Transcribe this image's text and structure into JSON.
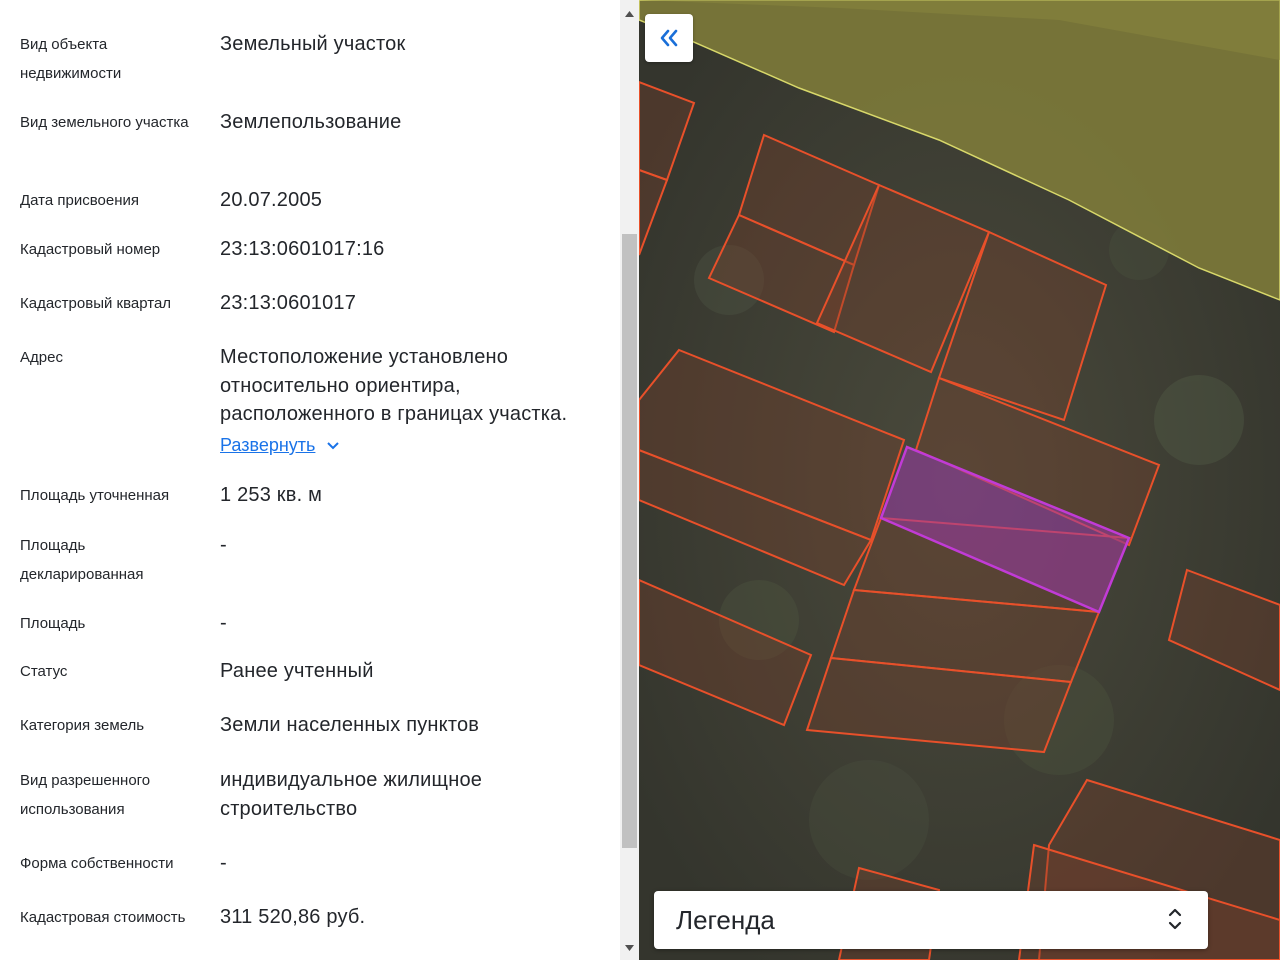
{
  "properties": [
    {
      "label": "Вид объекта недвижимости",
      "value": "Земельный участок"
    },
    {
      "label": "Вид земельного участка",
      "value": "Землепользование"
    },
    {
      "label": "Дата присвоения",
      "value": "20.07.2005"
    },
    {
      "label": "Кадастровый номер",
      "value": "23:13:0601017:16"
    },
    {
      "label": "Кадастровый квартал",
      "value": "23:13:0601017"
    },
    {
      "label": "Адрес",
      "value": "Местоположение установлено относительно ориентира, расположенного в границах участка.",
      "expand_label": "Развернуть"
    },
    {
      "label": "Площадь уточненная",
      "value": "1 253 кв. м"
    },
    {
      "label": "Площадь декларированная",
      "value": "-"
    },
    {
      "label": "Площадь",
      "value": "-"
    },
    {
      "label": "Статус",
      "value": "Ранее учтенный"
    },
    {
      "label": "Категория земель",
      "value": "Земли населенных пунктов"
    },
    {
      "label": "Вид разрешенного использования",
      "value": "индивидуальное жилищное строительство"
    },
    {
      "label": "Форма собственности",
      "value": "-"
    },
    {
      "label": "Кадастровая стоимость",
      "value": "311 520,86 руб."
    }
  ],
  "map": {
    "collapse_icon": "double-chevron-left-icon",
    "legend_title": "Легенда",
    "legend_toggle_icon": "up-down-chevron-icon",
    "colors": {
      "parcel_outline": "#e8502a",
      "selected_outline": "#c13bd6",
      "zone_fill": "#8a8a3e",
      "zone_outline": "#d8d86a",
      "accent": "#1a73e8"
    }
  }
}
